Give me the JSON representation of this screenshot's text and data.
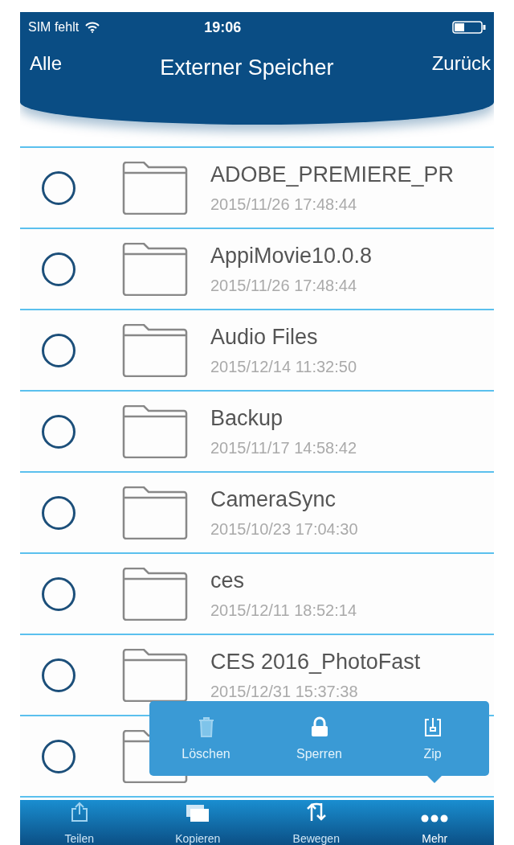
{
  "status_bar": {
    "carrier": "SIM fehlt",
    "time": "19:06"
  },
  "nav": {
    "left": "Alle",
    "title": "Externer Speicher",
    "right": "Zurück"
  },
  "files": [
    {
      "name": "ADOBE_PREMIERE_PR",
      "date": "2015/11/26 17:48:44",
      "selected": false
    },
    {
      "name": "AppiMovie10.0.8",
      "date": "2015/11/26 17:48:44",
      "selected": false
    },
    {
      "name": "Audio Files",
      "date": "2015/12/14 11:32:50",
      "selected": false
    },
    {
      "name": "Backup",
      "date": "2015/11/17 14:58:42",
      "selected": false
    },
    {
      "name": "CameraSync",
      "date": "2015/10/23 17:04:30",
      "selected": false
    },
    {
      "name": "ces",
      "date": "2015/12/11 18:52:14",
      "selected": false
    },
    {
      "name": "CES 2016_PhotoFast",
      "date": "2015/12/31 15:37:38",
      "selected": false
    },
    {
      "selected": false
    }
  ],
  "more_menu": [
    {
      "label": "Löschen",
      "kind": "trash"
    },
    {
      "label": "Sperren",
      "kind": "lock"
    },
    {
      "label": "Zip",
      "kind": "zip"
    }
  ],
  "tab_bar": [
    {
      "label": "Teilen",
      "kind": "share",
      "selected": false
    },
    {
      "label": "Kopieren",
      "kind": "copy",
      "selected": false
    },
    {
      "label": "Bewegen",
      "kind": "move",
      "selected": false
    },
    {
      "label": "Mehr",
      "kind": "more",
      "selected": true
    }
  ]
}
